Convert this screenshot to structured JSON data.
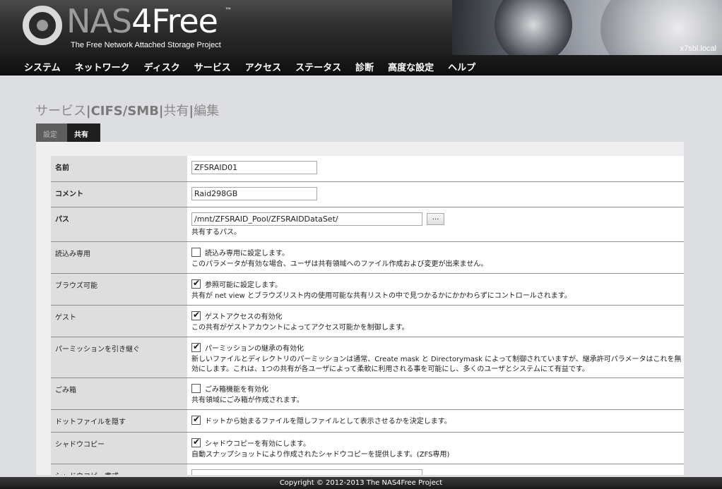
{
  "header": {
    "logo_nas": "NAS",
    "logo_free": "4Free",
    "logo_tm": "™",
    "tagline": "The Free Network Attached Storage Project",
    "hostname": "x7sbl.local"
  },
  "nav": {
    "items": [
      "システム",
      "ネットワーク",
      "ディスク",
      "サービス",
      "アクセス",
      "ステータス",
      "診断",
      "高度な設定",
      "ヘルプ"
    ]
  },
  "title": {
    "part1": "サービス",
    "sep1": "|",
    "part2": "CIFS/SMB",
    "sep2": "|",
    "part3": "共有",
    "sep3": "|",
    "part4": "編集"
  },
  "tabs": {
    "settings": "設定",
    "shares": "共有"
  },
  "form": {
    "name": {
      "label": "名前",
      "value": "ZFSRAID01"
    },
    "comment": {
      "label": "コメント",
      "value": "Raid298GB"
    },
    "path": {
      "label": "パス",
      "value": "/mnt/ZFSRAID_Pool/ZFSRAIDDataSet/",
      "browse": "...",
      "desc": "共有するパス。"
    },
    "readonly": {
      "label": "読込み専用",
      "checked": false,
      "check_label": "読込み専用に設定します。",
      "desc": "このパラメータが有効な場合、ユーザは共有領域へのファイル作成および変更が出来ません。"
    },
    "browsable": {
      "label": "ブラウズ可能",
      "checked": true,
      "check_label": "参照可能に設定します。",
      "desc": "共有が net view とブラウズリスト内の使用可能な共有リストの中で見つかるかにかかわらずにコントロールされます。"
    },
    "guest": {
      "label": "ゲスト",
      "checked": true,
      "check_label": "ゲストアクセスの有効化",
      "desc": "この共有がゲストアカウントによってアクセス可能かを制御します。"
    },
    "inherit": {
      "label": "パーミッションを引き継ぐ",
      "checked": true,
      "check_label": "パーミッションの継承の有効化",
      "desc": "新しいファイルとディレクトリのパーミッションは通常、Create mask と Directorymask によって制御されていますが、継承許可パラメータはこれを無効にします。これは、1つの共有が各ユーザによって柔軟に利用される事を可能にし、多くのユーザとシステムにて有益です。"
    },
    "recycle": {
      "label": "ごみ箱",
      "checked": false,
      "check_label": "ごみ箱機能を有効化",
      "desc": "共有領域にごみ箱が作成されます。"
    },
    "hide_dot": {
      "label": "ドットファイルを隠す",
      "checked": true,
      "check_label": "ドットから始まるファイルを隠しファイルとして表示させるかを決定します。"
    },
    "shadow_copy": {
      "label": "シャドウコピー",
      "checked": true,
      "check_label": "シャドウコピーを有効にします。",
      "desc": "自動スナップショットにより作成されたシャドウコピーを提供します。(ZFS専用)"
    },
    "shadow_format": {
      "label": "シャドウコピー書式"
    }
  },
  "footer": {
    "copyright": "Copyright © 2012-2013 The NAS4Free Project"
  }
}
